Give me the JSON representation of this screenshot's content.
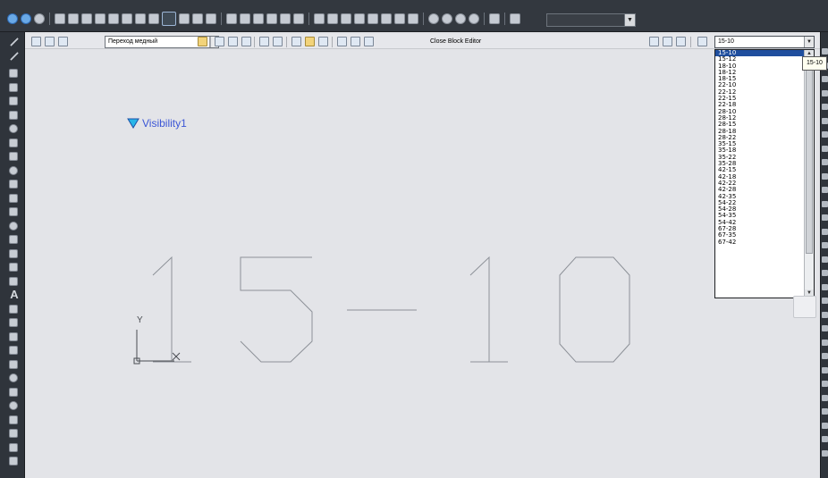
{
  "block_editor": {
    "block_name": "Переход медный",
    "close_label": "Close Block Editor"
  },
  "visibility": {
    "current_state": "15-10",
    "label": "Visibility1",
    "tooltip": "15-10",
    "states": [
      "15-10",
      "15-12",
      "18-10",
      "18-12",
      "18-15",
      "22-10",
      "22-12",
      "22-15",
      "22-18",
      "28-10",
      "28-12",
      "28-15",
      "28-18",
      "28-22",
      "35-15",
      "35-18",
      "35-22",
      "35-28",
      "42-15",
      "42-18",
      "42-22",
      "42-28",
      "42-35",
      "54-22",
      "54-28",
      "54-35",
      "54-42",
      "67-28",
      "67-35",
      "67-42"
    ],
    "selected_index": 0
  },
  "drawing": {
    "text": "15-10",
    "ucs_y_label": "Y"
  },
  "colors": {
    "canvas": "#e3e4e8",
    "selection": "#1f4e9e",
    "visibility_text": "#3b56d6",
    "visibility_marker": "#29b6e8"
  }
}
